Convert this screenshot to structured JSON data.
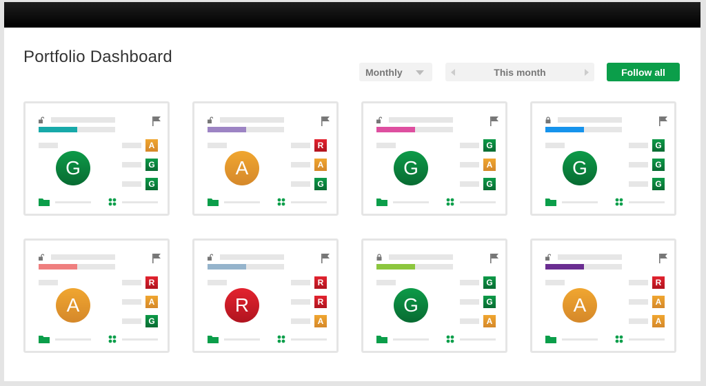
{
  "header": {
    "title": "Portfolio Dashboard"
  },
  "controls": {
    "period": "Monthly",
    "range": "This month",
    "follow_all": "Follow all"
  },
  "status_colors": {
    "G": "#0b8f42",
    "A": "#e39a2d",
    "R": "#c91a26"
  },
  "cards": [
    {
      "locked": false,
      "accent": "#17a9a9",
      "status": "G",
      "badges": [
        "A",
        "G",
        "G"
      ]
    },
    {
      "locked": false,
      "accent": "#9d84c4",
      "status": "A",
      "badges": [
        "R",
        "A",
        "G"
      ]
    },
    {
      "locked": false,
      "accent": "#de4fa0",
      "status": "G",
      "badges": [
        "G",
        "A",
        "G"
      ]
    },
    {
      "locked": true,
      "accent": "#1693ec",
      "status": "G",
      "badges": [
        "G",
        "G",
        "G"
      ]
    },
    {
      "locked": false,
      "accent": "#ef7f7f",
      "status": "A",
      "badges": [
        "R",
        "A",
        "G"
      ]
    },
    {
      "locked": false,
      "accent": "#95b4cc",
      "status": "R",
      "badges": [
        "R",
        "R",
        "A"
      ]
    },
    {
      "locked": true,
      "accent": "#8cc63e",
      "status": "G",
      "badges": [
        "G",
        "G",
        "A"
      ]
    },
    {
      "locked": false,
      "accent": "#6a2d91",
      "status": "A",
      "badges": [
        "R",
        "A",
        "A"
      ]
    }
  ]
}
